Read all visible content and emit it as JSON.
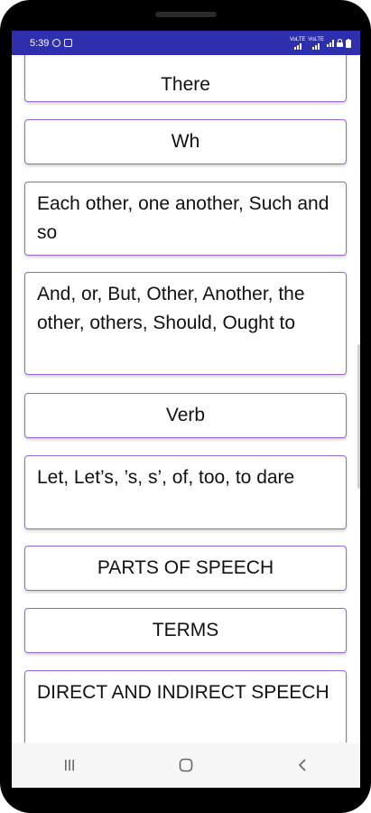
{
  "status_bar": {
    "time": "5:39",
    "icons": [
      "whatsapp-icon",
      "instagram-icon"
    ],
    "right_icons": [
      "volte-signal-icon",
      "volte-signal-icon",
      "wifi-icon",
      "lock-icon",
      "battery-icon"
    ],
    "signal_label_1": "VoLTE",
    "signal_label_2": "VoLTE",
    "color": "#2d2fae"
  },
  "items": [
    {
      "label": "There"
    },
    {
      "label": "Wh"
    },
    {
      "label": "Each other, one another, Such and so"
    },
    {
      "label": "And, or, But, Other, Another, the other, others, Should, Ought to"
    },
    {
      "label": "Verb"
    },
    {
      "label": "Let, Let’s, ’s, s’, of, too, to dare"
    },
    {
      "label": "PARTS OF SPEECH"
    },
    {
      "label": "TERMS"
    },
    {
      "label": "DIRECT AND INDIRECT SPEECH"
    }
  ],
  "nav_bar": {
    "recents": "recents-icon",
    "home": "home-icon",
    "back": "back-icon"
  },
  "colors": {
    "card_border": "#9b66cf",
    "status_bar": "#2d2fae"
  }
}
